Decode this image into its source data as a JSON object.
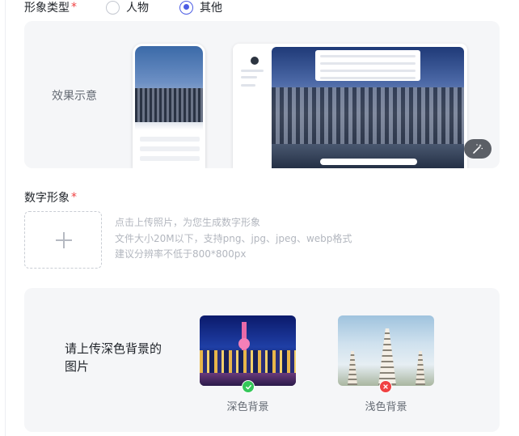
{
  "form": {
    "type_label": "形象类型",
    "required_mark": "*",
    "options": [
      {
        "label": "人物",
        "checked": false
      },
      {
        "label": "其他",
        "checked": true
      }
    ],
    "accent_color": "#4c5de4"
  },
  "preview": {
    "label": "效果示意",
    "magic_icon": "magic-wand-icon"
  },
  "digital": {
    "label": "数字形象",
    "required_mark": "*",
    "upload_icon": "plus-icon",
    "hints": [
      "点击上传照片，为您生成数字形象",
      "文件大小20M以下，支持png、jpg、jpeg、webp格式",
      "建议分辨率不低于800*800px"
    ]
  },
  "background_tip": {
    "text": "请上传深色背景的图片",
    "samples": [
      {
        "caption": "深色背景",
        "status": "ok",
        "status_icon": "check-icon",
        "status_color": "#34c759"
      },
      {
        "caption": "浅色背景",
        "status": "bad",
        "status_icon": "cross-icon",
        "status_color": "#f04142"
      }
    ]
  }
}
